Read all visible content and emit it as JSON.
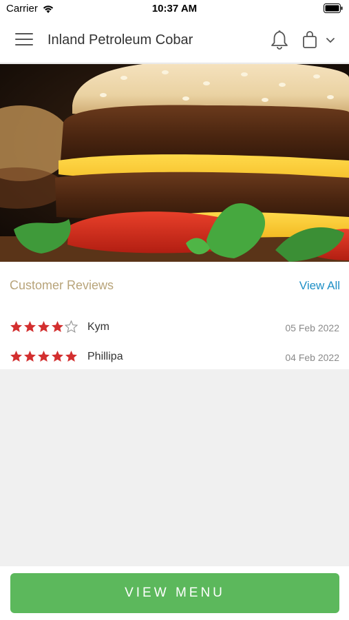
{
  "status_bar": {
    "carrier": "Carrier",
    "time": "10:37 AM",
    "icons": [
      "wifi-icon",
      "battery-icon"
    ]
  },
  "header": {
    "title": "Inland Petroleum Cobar",
    "icons": [
      "hamburger-menu-icon",
      "bell-icon",
      "shopping-bag-icon",
      "chevron-down-icon"
    ]
  },
  "reviews": {
    "heading": "Customer Reviews",
    "view_all_label": "View All",
    "items": [
      {
        "name": "Kym",
        "rating": 4,
        "max_rating": 5,
        "date": "05 Feb 2022"
      },
      {
        "name": "Phillipa",
        "rating": 5,
        "max_rating": 5,
        "date": "04 Feb 2022"
      }
    ]
  },
  "footer": {
    "view_menu_label": "VIEW MENU"
  },
  "colors": {
    "star": "#d32f2f",
    "accent_button": "#5cb85c",
    "link": "#1e8fc6",
    "heading": "#b8a47a"
  }
}
